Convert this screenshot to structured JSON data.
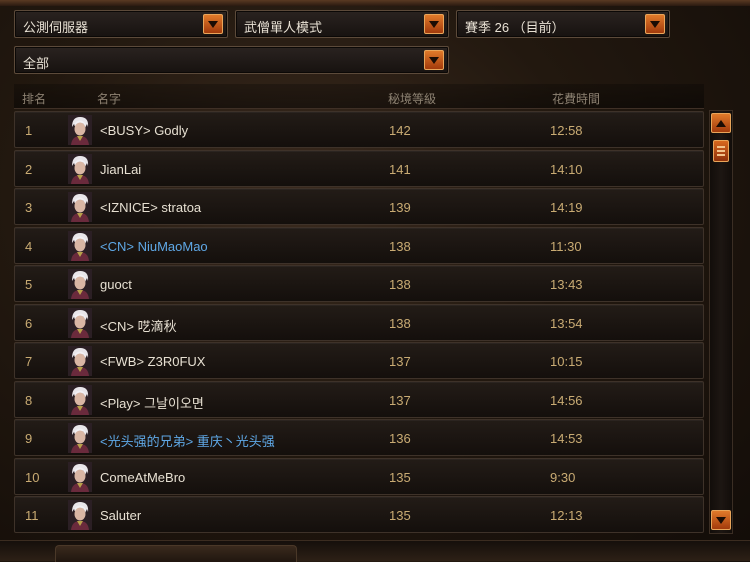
{
  "filters": {
    "server": "公測伺服器",
    "mode": "武僧單人模式",
    "season": "賽季 26 （目前）",
    "class_filter": "全部"
  },
  "columns": {
    "rank": "排名",
    "name": "名字",
    "level": "秘境等級",
    "time": "花費時間"
  },
  "rows": [
    {
      "rank": "1",
      "name": "<BUSY> Godly",
      "level": "142",
      "time": "12:58",
      "clan_color": false
    },
    {
      "rank": "2",
      "name": "JianLai",
      "level": "141",
      "time": "14:10",
      "clan_color": false
    },
    {
      "rank": "3",
      "name": "<IZNICE> stratoa",
      "level": "139",
      "time": "14:19",
      "clan_color": false
    },
    {
      "rank": "4",
      "name": "<CN> NiuMaoMao",
      "level": "138",
      "time": "11:30",
      "clan_color": true
    },
    {
      "rank": "5",
      "name": "guoct",
      "level": "138",
      "time": "13:43",
      "clan_color": false
    },
    {
      "rank": "6",
      "name": "<CN> 呓滴秋",
      "level": "138",
      "time": "13:54",
      "clan_color": false
    },
    {
      "rank": "7",
      "name": "<FWB> Z3R0FUX",
      "level": "137",
      "time": "10:15",
      "clan_color": false
    },
    {
      "rank": "8",
      "name": "<Play> 그날이오면",
      "level": "137",
      "time": "14:56",
      "clan_color": false
    },
    {
      "rank": "9",
      "name": "<光头强的兄弟> 重庆丶光头强",
      "level": "136",
      "time": "14:53",
      "clan_color": true
    },
    {
      "rank": "10",
      "name": "ComeAtMeBro",
      "level": "135",
      "time": "9:30",
      "clan_color": false
    },
    {
      "rank": "11",
      "name": "Saluter",
      "level": "135",
      "time": "12:13",
      "clan_color": false
    }
  ],
  "icons": {
    "dropdown": "chevron-down-icon",
    "portrait": "monk-portrait-icon",
    "scroll_up": "arrow-up-icon",
    "scroll_down": "arrow-down-icon"
  },
  "colors": {
    "accent_orange": "#c8561a",
    "clan_blue": "#5fa8e6",
    "value_gold": "#c9ab73"
  }
}
